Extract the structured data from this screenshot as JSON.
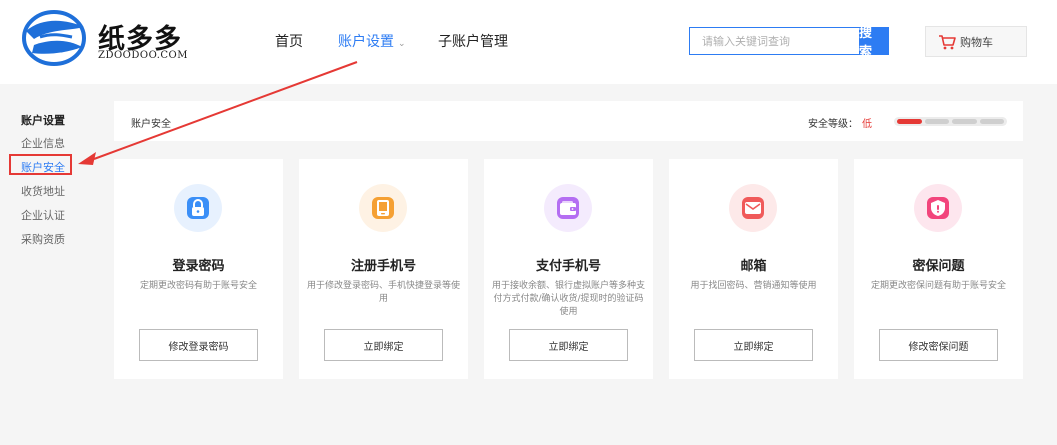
{
  "brand": {
    "name": "纸多多",
    "domain": "ZDOODOO.COM"
  },
  "nav": [
    {
      "label": "首页"
    },
    {
      "label": "账户设置",
      "chevron": "⌄",
      "active": true
    },
    {
      "label": "子账户管理"
    }
  ],
  "search": {
    "placeholder": "请输入关键词查询",
    "button_label": "搜 索"
  },
  "cart": {
    "label": "购物车",
    "icon": "cart-icon"
  },
  "sidebar": {
    "title": "账户设置",
    "items": [
      {
        "label": "企业信息"
      },
      {
        "label": "账户安全",
        "active": true
      },
      {
        "label": "收货地址"
      },
      {
        "label": "企业认证"
      },
      {
        "label": "采购资质"
      }
    ]
  },
  "security": {
    "title": "账户安全",
    "level_label": "安全等级：",
    "level_value": "低",
    "level_filled": 1,
    "level_total": 4
  },
  "cards": [
    {
      "title": "登录密码",
      "desc": "定期更改密码有助于账号安全",
      "button": "修改登录密码",
      "icon": "lock-icon",
      "color": "#3b8ff7",
      "bg": "#e7f1fe"
    },
    {
      "title": "注册手机号",
      "desc": "用于修改登录密码、手机快捷登录等使用",
      "button": "立即绑定",
      "icon": "phone-icon",
      "color": "#f5a033",
      "bg": "#fef2e4"
    },
    {
      "title": "支付手机号",
      "desc": "用于接收余额、银行虚拟账户等多种支付方式付款/确认收货/提现时的验证码使用",
      "button": "立即绑定",
      "icon": "wallet-icon",
      "color": "#b46ef2",
      "bg": "#f4ebfd"
    },
    {
      "title": "邮箱",
      "desc": "用于找回密码、营销通知等使用",
      "button": "立即绑定",
      "icon": "mail-icon",
      "color": "#f05a5a",
      "bg": "#fde9e9"
    },
    {
      "title": "密保问题",
      "desc": "定期更改密保问题有助于账号安全",
      "button": "修改密保问题",
      "icon": "shield-icon",
      "color": "#f2457c",
      "bg": "#fde6ee"
    }
  ],
  "colors": {
    "accent": "#2d7cf3",
    "danger": "#e53935"
  }
}
